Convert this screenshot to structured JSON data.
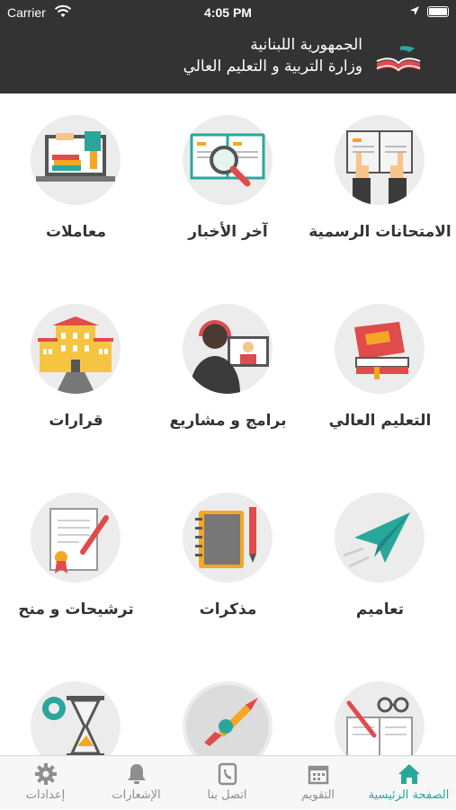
{
  "status_bar": {
    "carrier": "Carrier",
    "time": "4:05 PM"
  },
  "header": {
    "title_line1": "الجمهورية اللبنانية",
    "title_line2": "وزارة التربية و التعليم العالي",
    "logo_icon": "book-logo-icon"
  },
  "tiles": [
    {
      "label": "الامتحانات الرسمية",
      "icon": "exam-book-hands-icon"
    },
    {
      "label": "آخر الأخبار",
      "icon": "magnifier-book-icon"
    },
    {
      "label": "معاملات",
      "icon": "laptop-documents-icon"
    },
    {
      "label": "التعليم العالي",
      "icon": "books-stack-icon"
    },
    {
      "label": "برامج و مشاريع",
      "icon": "video-call-icon"
    },
    {
      "label": "قرارات",
      "icon": "building-icon"
    },
    {
      "label": "تعاميم",
      "icon": "paper-plane-icon"
    },
    {
      "label": "مذكرات",
      "icon": "notebook-pen-icon"
    },
    {
      "label": "ترشيحات و منح",
      "icon": "certificate-pen-icon"
    },
    {
      "label": "",
      "icon": "notebook-glasses-icon"
    },
    {
      "label": "",
      "icon": "rocket-pencil-icon"
    },
    {
      "label": "",
      "icon": "hourglass-gear-icon"
    }
  ],
  "tab_bar": {
    "active_color": "#2aa79b",
    "items": [
      {
        "label": "الصفحة الرئيسية",
        "icon": "home-icon",
        "active": true
      },
      {
        "label": "التقويم",
        "icon": "calendar-icon",
        "active": false
      },
      {
        "label": "اتصل بنا",
        "icon": "phone-icon",
        "active": false
      },
      {
        "label": "الإشعارات",
        "icon": "bell-icon",
        "active": false
      },
      {
        "label": "إعدادات",
        "icon": "gear-icon",
        "active": false
      }
    ]
  }
}
